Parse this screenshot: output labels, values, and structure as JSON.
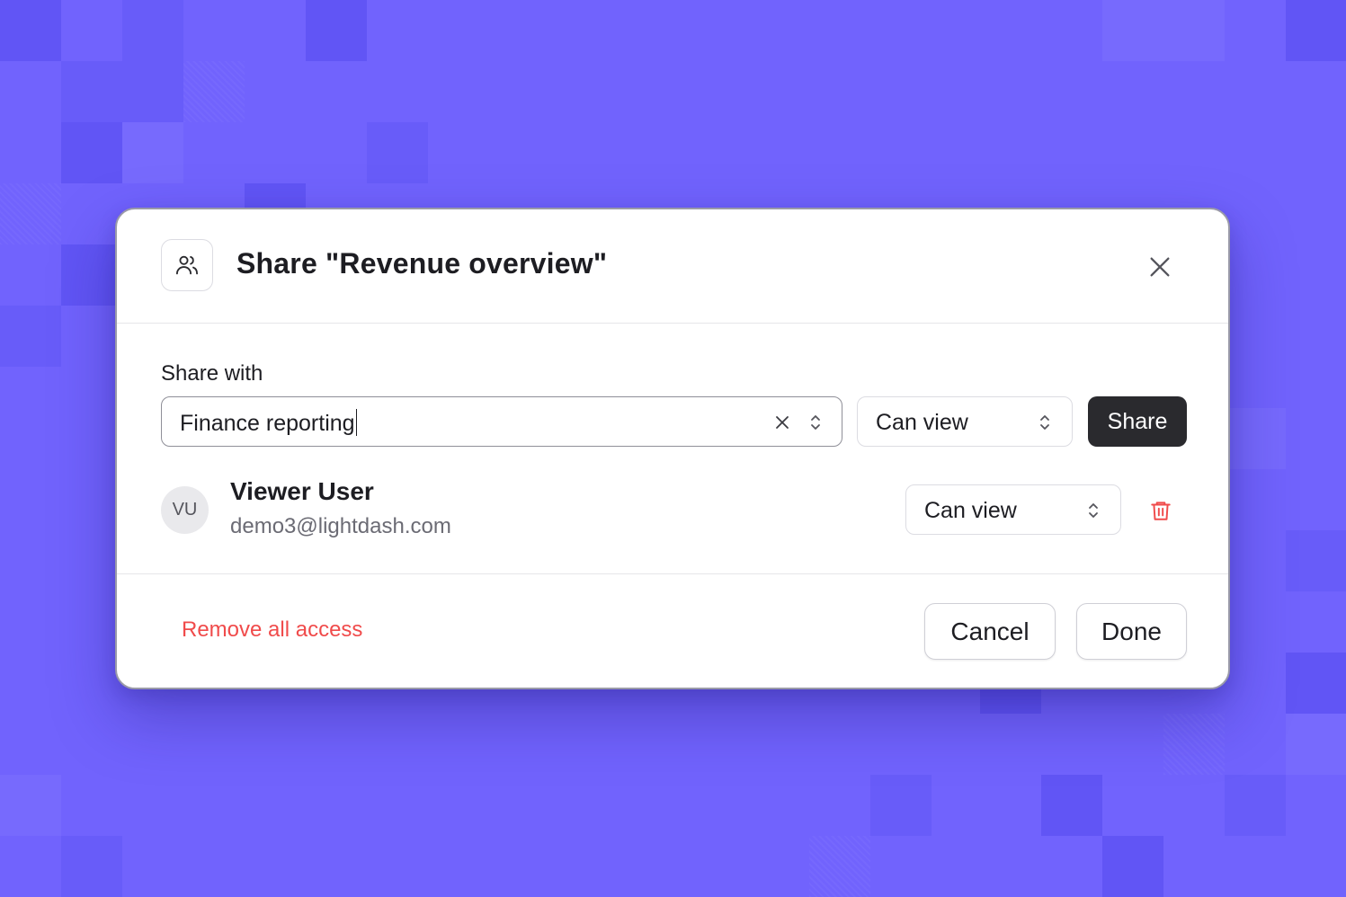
{
  "icons": {
    "header": "users-icon",
    "close": "close-icon",
    "clear": "clear-icon",
    "chevron": "chevron-up-down-icon",
    "delete": "trash-icon"
  },
  "colors": {
    "background": "#7163fd",
    "primary_button": "#2a2a2e",
    "danger": "#f04b4b"
  },
  "modal": {
    "title": "Share \"Revenue overview\""
  },
  "share": {
    "label": "Share with",
    "input_value": "Finance reporting",
    "permission": "Can view",
    "share_button": "Share"
  },
  "users": [
    {
      "initials": "VU",
      "name": "Viewer User",
      "email": "demo3@lightdash.com",
      "permission": "Can view"
    }
  ],
  "footer": {
    "remove_all": "Remove all access",
    "cancel": "Cancel",
    "done": "Done"
  }
}
